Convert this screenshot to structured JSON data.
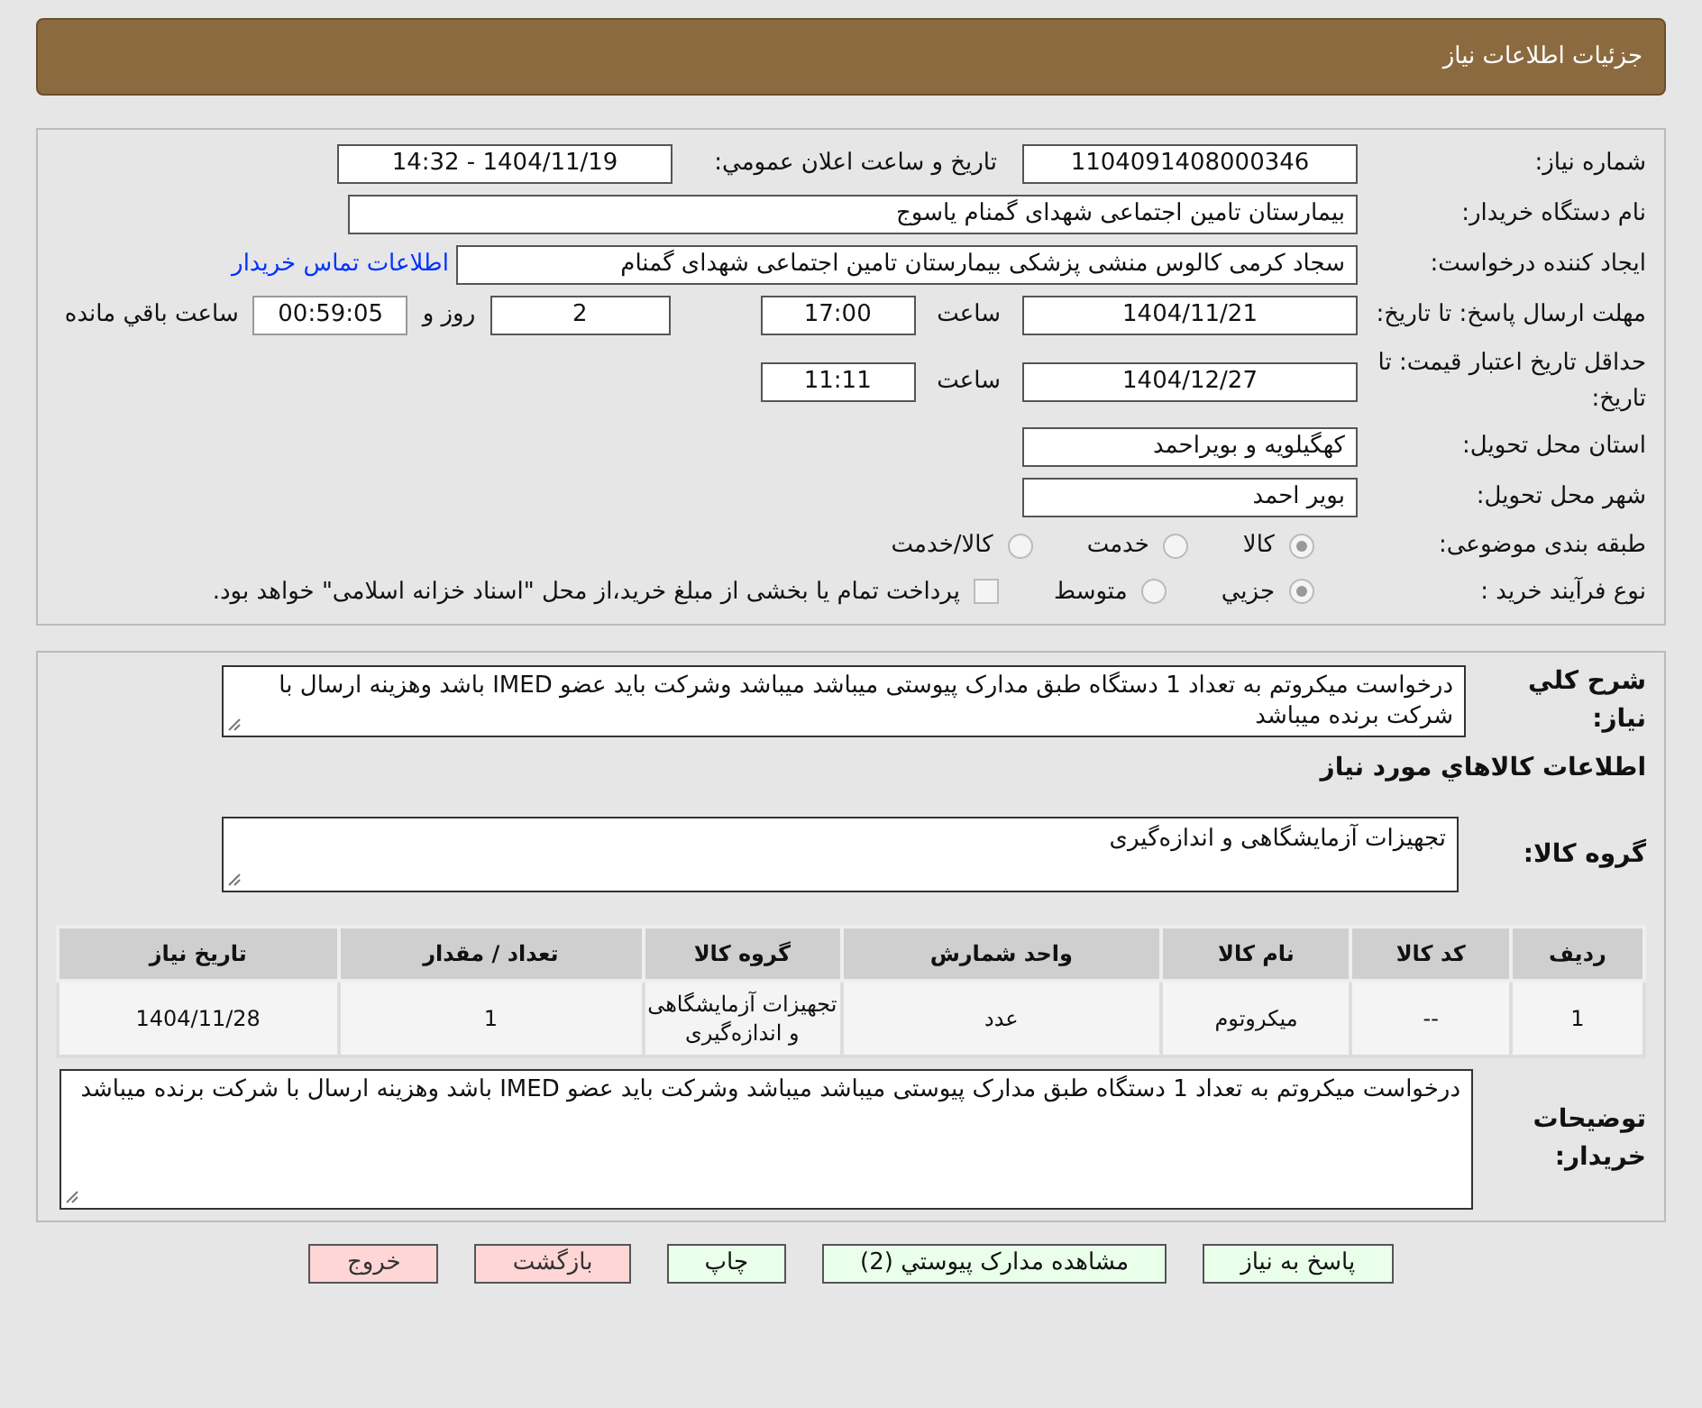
{
  "header": {
    "title": "جزئیات اطلاعات نیاز"
  },
  "form": {
    "need_number": {
      "label": "شماره نیاز:",
      "value": "1104091408000346"
    },
    "announce": {
      "label": "تاریخ و ساعت اعلان عمومي:",
      "value": "1404/11/19 - 14:32"
    },
    "buyer": {
      "label": "نام دستگاه خریدار:",
      "value": "بیمارستان تامین اجتماعی شهدای گمنام یاسوج"
    },
    "creator": {
      "label": "ایجاد کننده درخواست:",
      "value": "سجاد کرمی کالوس  منشی پزشکی  بیمارستان تامین اجتماعی شهدای گمنام",
      "link": "اطلاعات تماس خریدار"
    },
    "deadline": {
      "label": "مهلت ارسال پاسخ: تا تاریخ:",
      "date": "1404/11/21",
      "time_label": "ساعت",
      "time": "17:00",
      "days": "2",
      "days_label": "روز و",
      "remaining": "00:59:05",
      "remaining_label": "ساعت باقي مانده"
    },
    "validity": {
      "label": "حداقل تاریخ اعتبار قیمت: تا تاریخ:",
      "date": "1404/12/27",
      "time_label": "ساعت",
      "time": "11:11"
    },
    "province": {
      "label": "استان محل تحویل:",
      "value": "کهگیلویه و بویراحمد"
    },
    "city": {
      "label": "شهر محل تحویل:",
      "value": "بویر احمد"
    },
    "category": {
      "label": "طبقه بندی موضوعی:",
      "options": [
        {
          "label": "کالا",
          "selected": true
        },
        {
          "label": "خدمت",
          "selected": false
        },
        {
          "label": "کالا/خدمت",
          "selected": false
        }
      ]
    },
    "process": {
      "label": "نوع فرآیند خرید :",
      "options": [
        {
          "label": "جزيي",
          "selected": true
        },
        {
          "label": "متوسط",
          "selected": false
        }
      ],
      "treasury": {
        "label": "پرداخت تمام یا بخشی از مبلغ خرید،از محل \"اسناد خزانه اسلامی\" خواهد بود.",
        "checked": false
      }
    }
  },
  "details": {
    "summary_label": "شرح کلي نیاز:",
    "summary": "درخواست  میکروتم به تعداد 1 دستگاه طبق مدارک پیوستی  میباشد  میباشد وشرکت باید عضو IMED باشد وهزینه ارسال با شرکت برنده میباشد",
    "goods_title": "اطلاعات کالاهاي مورد نیاز",
    "group_label": "گروه کالا:",
    "group": "تجهیزات آزمایشگاهی و اندازه‌گیری",
    "table": {
      "columns": [
        "ردیف",
        "کد کالا",
        "نام کالا",
        "واحد شمارش",
        "گروه کالا",
        "تعداد / مقدار",
        "تاریخ نیاز"
      ],
      "rows": [
        [
          "1",
          "--",
          "میکروتوم",
          "عدد",
          "تجهیزات آزمایشگاهی و اندازه‌گیری",
          "1",
          "1404/11/28"
        ]
      ]
    },
    "notes_label": "توضیحات خریدار:",
    "notes": "درخواست  میکروتم به تعداد 1 دستگاه طبق مدارک پیوستی  میباشد  میباشد وشرکت باید عضو IMED باشد وهزینه ارسال با شرکت برنده میباشد"
  },
  "buttons": [
    {
      "label": "پاسخ به نیاز",
      "kind": "primary"
    },
    {
      "label": "مشاهده مدارک پیوستي (2)",
      "kind": "primary"
    },
    {
      "label": "چاپ",
      "kind": "primary"
    },
    {
      "label": "بازگشت",
      "kind": "danger"
    },
    {
      "label": "خروج",
      "kind": "danger"
    }
  ]
}
